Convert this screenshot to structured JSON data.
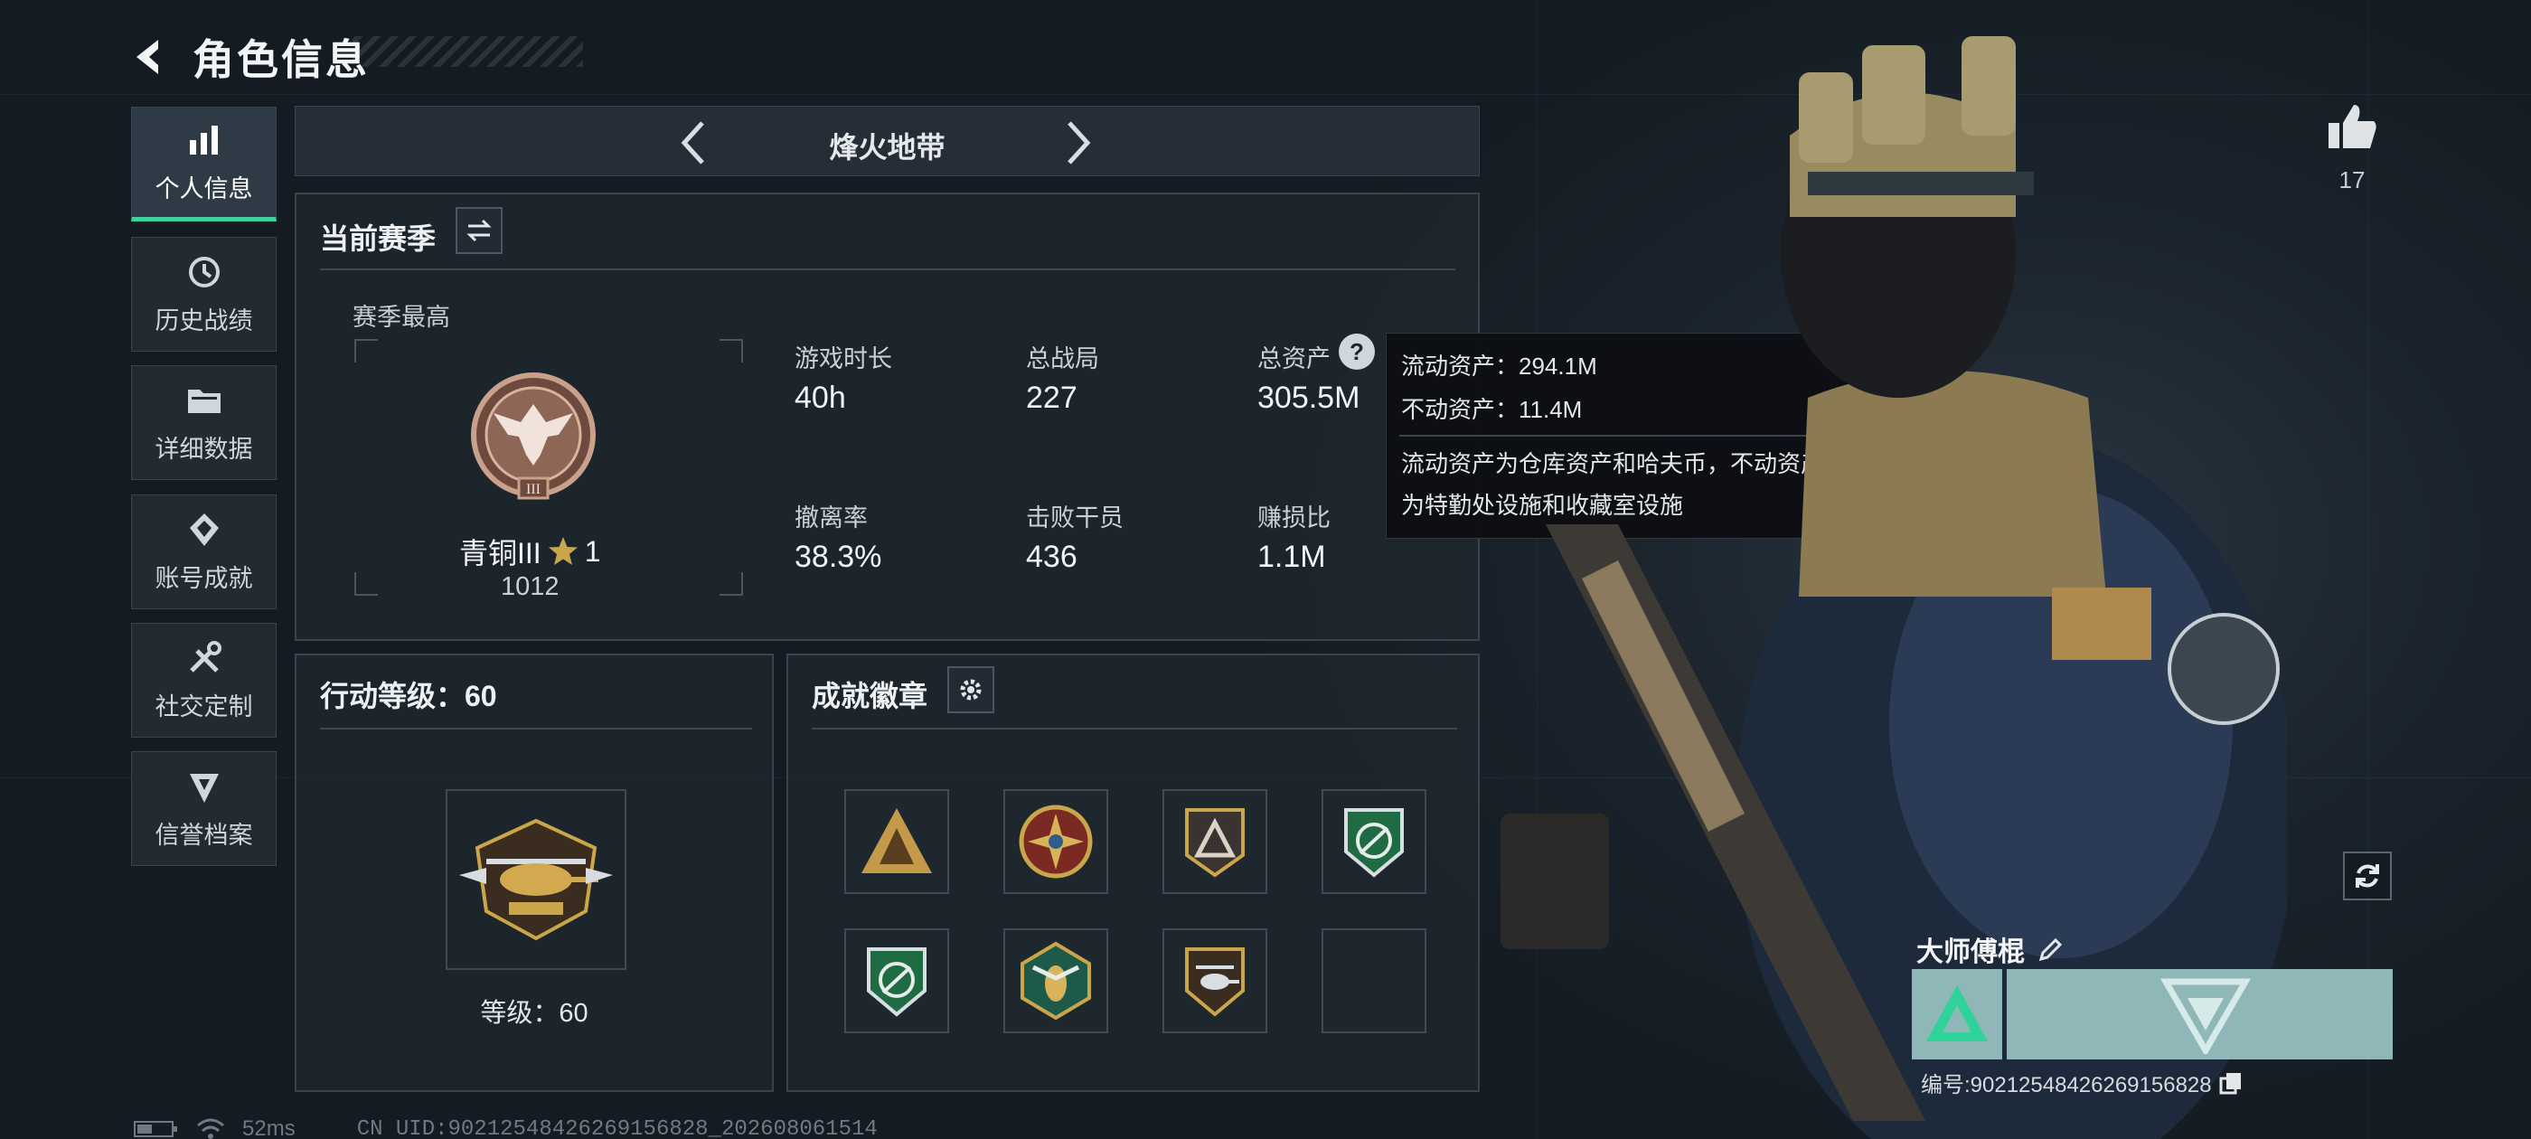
{
  "header": {
    "title": "角色信息"
  },
  "sidebar": {
    "items": [
      {
        "label": "个人信息",
        "icon": "bar-chart-icon",
        "active": true
      },
      {
        "label": "历史战绩",
        "icon": "history-clock-icon",
        "active": false
      },
      {
        "label": "详细数据",
        "icon": "folder-icon",
        "active": false
      },
      {
        "label": "账号成就",
        "icon": "achievement-icon",
        "active": false
      },
      {
        "label": "社交定制",
        "icon": "tools-icon",
        "active": false
      },
      {
        "label": "信誉档案",
        "icon": "shield-badge-icon",
        "active": false
      }
    ]
  },
  "mode_tab": {
    "name": "烽火地带"
  },
  "season": {
    "title": "当前赛季",
    "best_label": "赛季最高",
    "rank_name": "青铜III",
    "rank_stars": "1",
    "rank_score": "1012",
    "stats": [
      {
        "label": "游戏时长",
        "value": "40h"
      },
      {
        "label": "总战局",
        "value": "227"
      },
      {
        "label": "总资产",
        "value": "305.5M"
      },
      {
        "label": "撤离率",
        "value": "38.3%"
      },
      {
        "label": "击败干员",
        "value": "436"
      },
      {
        "label": "赚损比",
        "value": "1.1M"
      }
    ]
  },
  "tooltip": {
    "line1": "流动资产：294.1M",
    "line2": "不动资产：11.4M",
    "desc1": "流动资产为仓库资产和哈夫币，不动资产",
    "desc2": "为特勤处设施和收藏室设施"
  },
  "action_level": {
    "title": "行动等级：60",
    "level_text": "等级：60"
  },
  "badges": {
    "title": "成就徽章",
    "items": [
      "triangle-army-badge",
      "compass-star-badge",
      "mountain-triangle-badge",
      "green-shield-badge",
      "green-shield-badge-2",
      "hornet-badge",
      "helicopter-badge",
      "empty-badge-slot"
    ]
  },
  "likes": {
    "count": "17"
  },
  "player": {
    "name": "大师傅棍",
    "id_text": "编号:9021254842626915682‌8"
  },
  "status_bar": {
    "ping": "52ms",
    "uid": "CN UID:90212548426269156828_202608061514"
  },
  "colors": {
    "accent": "#3fd19a",
    "card_teal": "#8fb7b8",
    "gold": "#c9a64a"
  }
}
